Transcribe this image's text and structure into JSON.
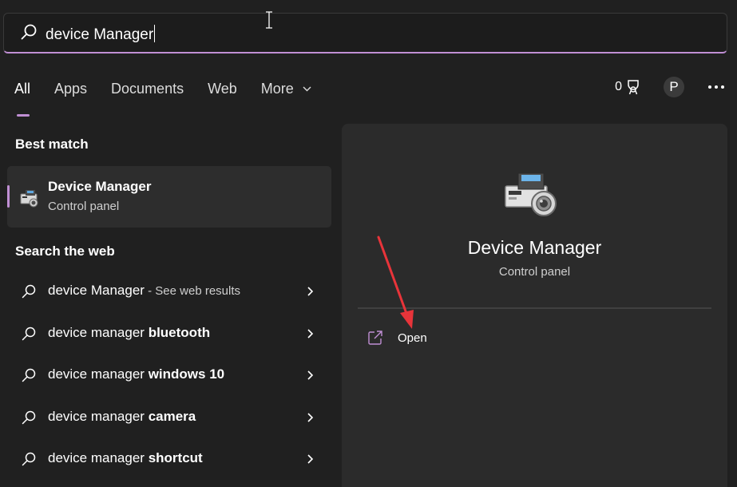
{
  "search": {
    "query": "device Manager"
  },
  "tabs": [
    {
      "label": "All",
      "active": true
    },
    {
      "label": "Apps"
    },
    {
      "label": "Documents"
    },
    {
      "label": "Web"
    },
    {
      "label": "More"
    }
  ],
  "header_tools": {
    "points": "0",
    "avatar_initial": "P"
  },
  "best_match": {
    "section_title": "Best match",
    "name": "Device Manager",
    "type": "Control panel"
  },
  "web_search": {
    "section_title": "Search the web",
    "items": [
      {
        "prefix": "device Manager",
        "bold": "",
        "hint": " - See web results"
      },
      {
        "prefix": "device manager ",
        "bold": "bluetooth",
        "hint": ""
      },
      {
        "prefix": "device manager ",
        "bold": "windows 10",
        "hint": ""
      },
      {
        "prefix": "device manager ",
        "bold": "camera",
        "hint": ""
      },
      {
        "prefix": "device manager ",
        "bold": "shortcut",
        "hint": ""
      }
    ]
  },
  "detail": {
    "name": "Device Manager",
    "type": "Control panel",
    "actions": [
      {
        "label": "Open",
        "icon": "open-external-icon"
      }
    ]
  },
  "colors": {
    "background": "#202020",
    "accent": "#c08fd4",
    "panel": "#2b2b2b",
    "annotation_arrow": "#e8343a"
  },
  "icons": {
    "search": "magnifier-icon",
    "chevron": "chevron-right-icon",
    "points": "trophy-icon",
    "more": "ellipsis-icon",
    "app": "device-manager-icon"
  }
}
